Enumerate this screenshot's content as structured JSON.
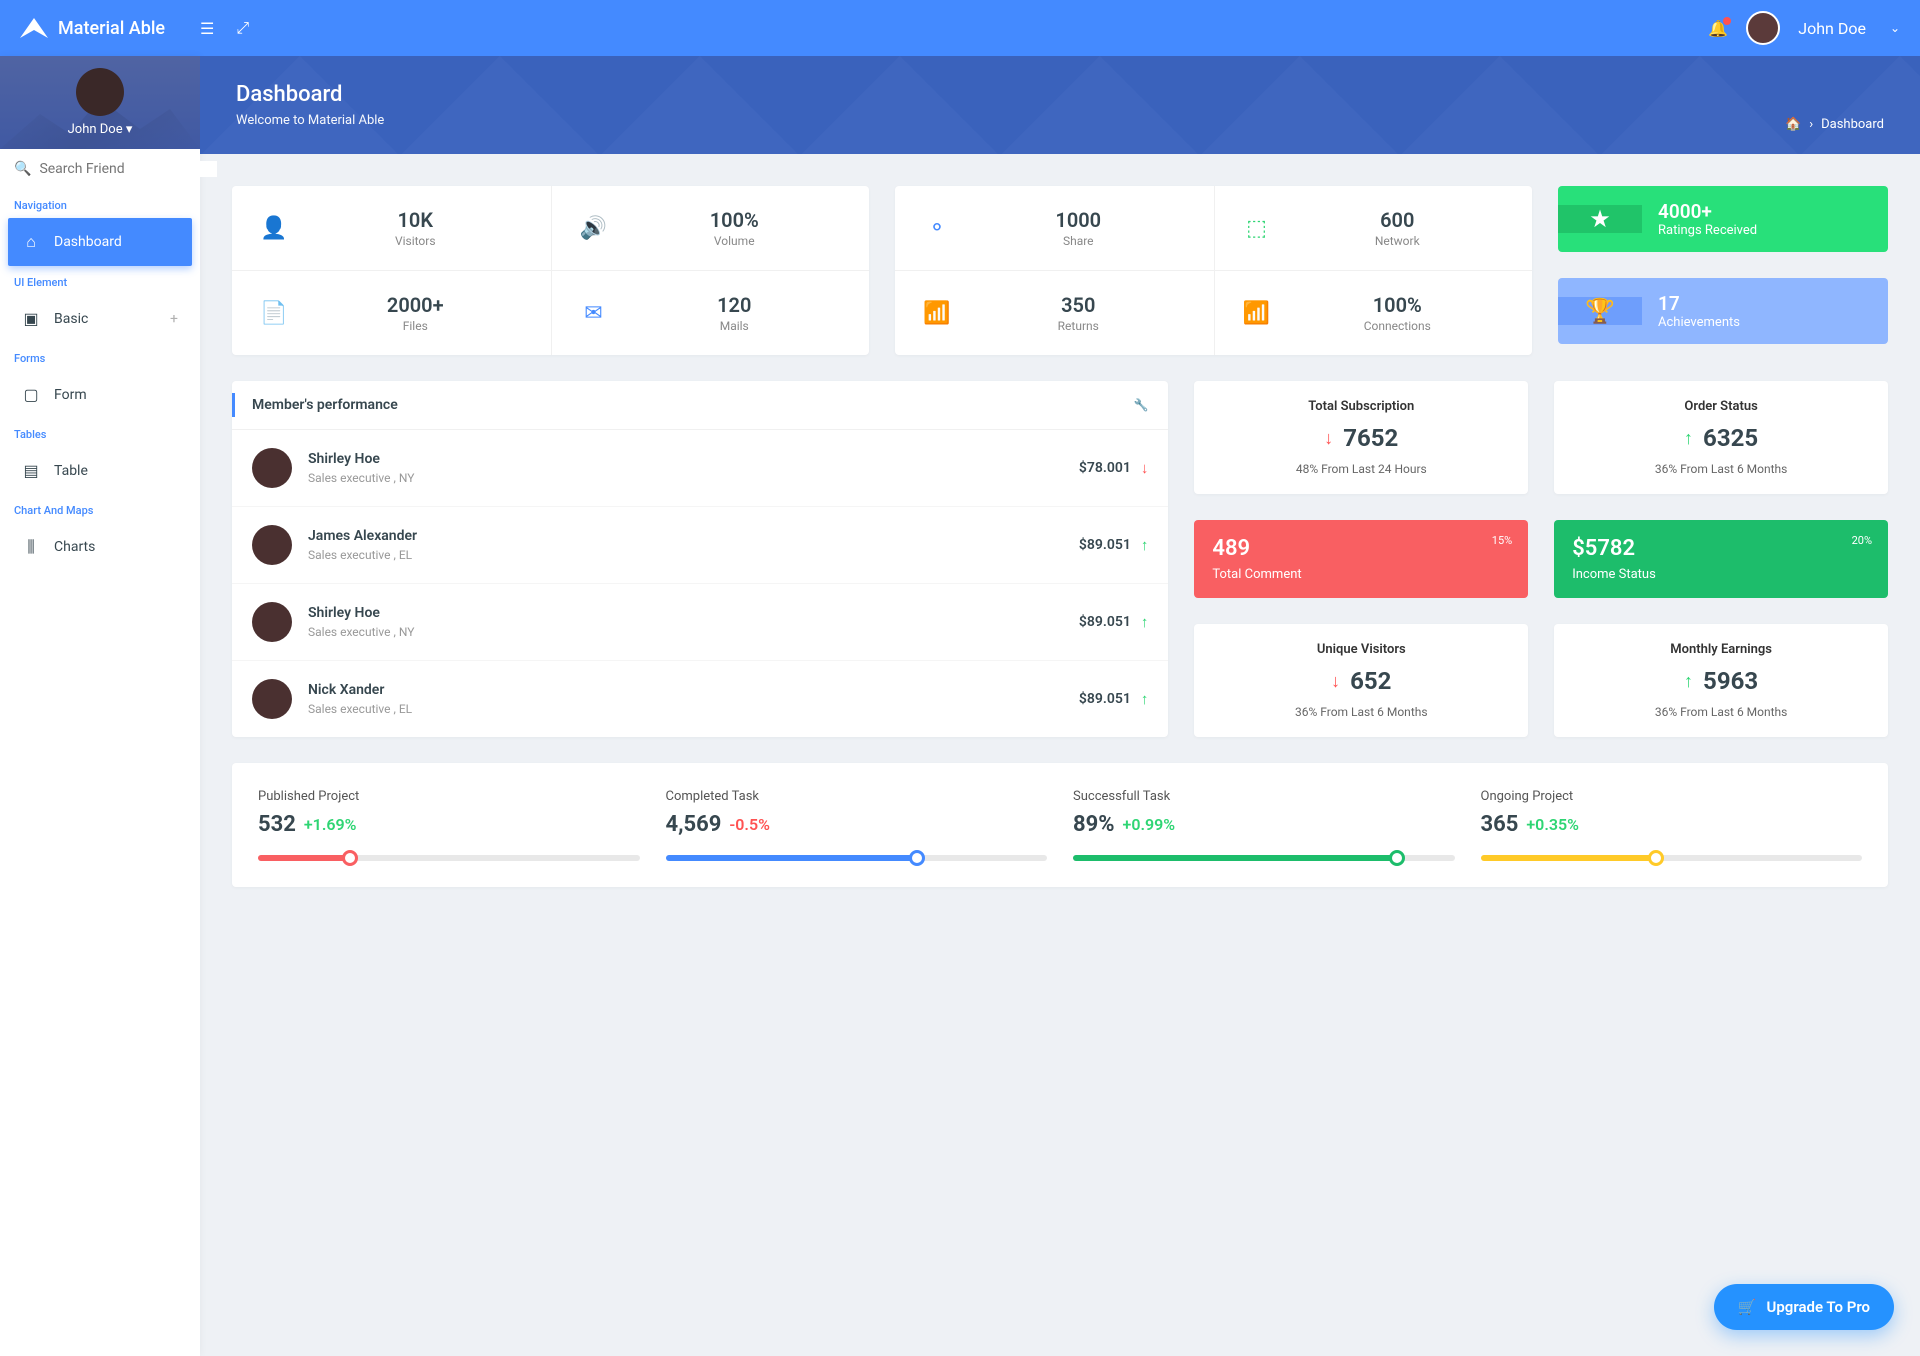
{
  "app_name": "Material Able",
  "user": {
    "name": "John Doe"
  },
  "sidebar": {
    "search_placeholder": "Search Friend",
    "user_name": "John Doe",
    "groups": [
      {
        "label": "Navigation",
        "items": [
          {
            "label": "Dashboard",
            "icon": "⌂",
            "active": true
          }
        ]
      },
      {
        "label": "UI Element",
        "items": [
          {
            "label": "Basic",
            "icon": "▣",
            "expandable": true
          }
        ]
      },
      {
        "label": "Forms",
        "items": [
          {
            "label": "Form",
            "icon": "▢"
          }
        ]
      },
      {
        "label": "Tables",
        "items": [
          {
            "label": "Table",
            "icon": "▤"
          }
        ]
      },
      {
        "label": "Chart And Maps",
        "items": [
          {
            "label": "Charts",
            "icon": "⫼"
          }
        ]
      }
    ]
  },
  "page": {
    "title": "Dashboard",
    "subtitle": "Welcome to Material Able",
    "breadcrumb": "Dashboard"
  },
  "stats_left": [
    {
      "value": "10K",
      "label": "Visitors",
      "icon": "user"
    },
    {
      "value": "100%",
      "label": "Volume",
      "icon": "vol"
    },
    {
      "value": "2000+",
      "label": "Files",
      "icon": "file"
    },
    {
      "value": "120",
      "label": "Mails",
      "icon": "mail"
    }
  ],
  "stats_mid": [
    {
      "value": "1000",
      "label": "Share",
      "icon": "share"
    },
    {
      "value": "600",
      "label": "Network",
      "icon": "net"
    },
    {
      "value": "350",
      "label": "Returns",
      "icon": "chart"
    },
    {
      "value": "100%",
      "label": "Connections",
      "icon": "wifi"
    }
  ],
  "ribbons": [
    {
      "value": "4000+",
      "label": "Ratings Received",
      "icon": "★",
      "color": "green"
    },
    {
      "value": "17",
      "label": "Achievements",
      "icon": "🏆",
      "color": "blue"
    }
  ],
  "performance": {
    "title": "Member's performance",
    "rows": [
      {
        "name": "Shirley Hoe",
        "role": "Sales executive , NY",
        "value": "$78.001",
        "dir": "down"
      },
      {
        "name": "James Alexander",
        "role": "Sales executive , EL",
        "value": "$89.051",
        "dir": "up"
      },
      {
        "name": "Shirley Hoe",
        "role": "Sales executive , NY",
        "value": "$89.051",
        "dir": "up"
      },
      {
        "name": "Nick Xander",
        "role": "Sales executive , EL",
        "value": "$89.051",
        "dir": "up"
      }
    ]
  },
  "kpis": [
    {
      "title": "Total Subscription",
      "value": "7652",
      "dir": "down",
      "desc": "48% From Last 24 Hours"
    },
    {
      "title": "Order Status",
      "value": "6325",
      "dir": "up",
      "desc": "36% From Last 6 Months"
    }
  ],
  "fills": [
    {
      "value": "489",
      "label": "Total Comment",
      "pct": "15%",
      "color": "red"
    },
    {
      "value": "$5782",
      "label": "Income Status",
      "pct": "20%",
      "color": "green"
    }
  ],
  "kpis2": [
    {
      "title": "Unique Visitors",
      "value": "652",
      "dir": "down",
      "desc": "36% From Last 6 Months"
    },
    {
      "title": "Monthly Earnings",
      "value": "5963",
      "dir": "up",
      "desc": "36% From Last 6 Months"
    }
  ],
  "projects": [
    {
      "title": "Published Project",
      "value": "532",
      "change": "+1.69%",
      "cdir": "up",
      "color": "#f95f62",
      "pct": 24
    },
    {
      "title": "Completed Task",
      "value": "4,569",
      "change": "-0.5%",
      "cdir": "down",
      "color": "#448aff",
      "pct": 66
    },
    {
      "title": "Successfull Task",
      "value": "89%",
      "change": "+0.99%",
      "cdir": "up",
      "color": "#1dbd6b",
      "pct": 85
    },
    {
      "title": "Ongoing Project",
      "value": "365",
      "change": "+0.35%",
      "cdir": "up",
      "color": "#ffca28",
      "pct": 46
    }
  ],
  "fab_label": "Upgrade To Pro"
}
